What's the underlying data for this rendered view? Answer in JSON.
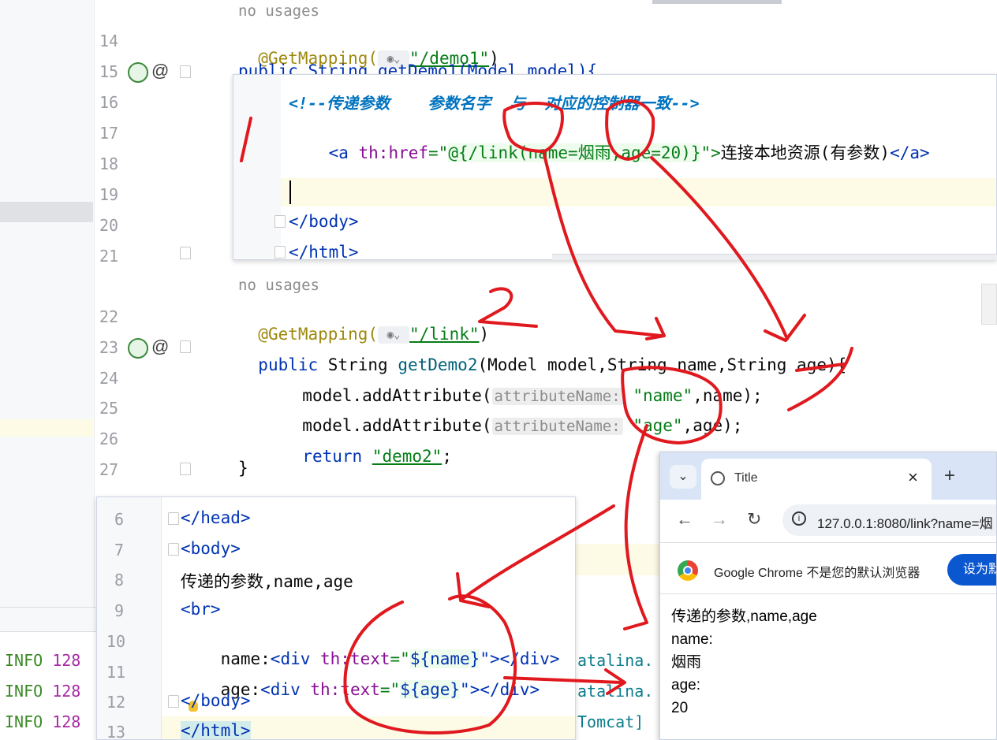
{
  "editor_main": {
    "lines": [
      {
        "num": "",
        "usage": "no usages"
      },
      {
        "num": "14",
        "text": "@GetMapping(\"/demo1\")"
      },
      {
        "num": "15",
        "text": "public String getDemo1(Model model){"
      },
      {
        "num": "16"
      },
      {
        "num": "17"
      },
      {
        "num": "18"
      },
      {
        "num": "19"
      },
      {
        "num": "20"
      },
      {
        "num": "21"
      },
      {
        "num": "",
        "usage": "no usages"
      },
      {
        "num": "22"
      },
      {
        "num": "23"
      },
      {
        "num": "24"
      },
      {
        "num": "25"
      },
      {
        "num": "26"
      },
      {
        "num": "27"
      }
    ],
    "annotation": "@GetMapping(",
    "path_demo1": "\"/demo1\"",
    "path_link": "\"/link\"",
    "close_paren": ")",
    "line15_text": "public String getDemo1(Model model){",
    "line23": {
      "kw": "public",
      "text1": " String ",
      "method": "getDemo2",
      "text2": "(Model model,String name,String age){"
    },
    "line24": {
      "text": "model.addAttribute(",
      "hint": "attributeName:",
      "str": "\"name\"",
      "rest": ",name);"
    },
    "line25": {
      "text": "model.addAttribute(",
      "hint": "attributeName:",
      "str": "\"age\"",
      "rest": ",age);"
    },
    "line26": {
      "kw": "return",
      "str": "\"demo2\"",
      "rest": ";"
    },
    "line27": "}",
    "at_symbol": "@"
  },
  "popup_html1": {
    "comment": "<!--传递参数    参数名字  与  对应的控制器一致-->",
    "line17": {
      "open": "<a",
      "attr": " th:href",
      "eq": "=\"",
      "expr": "@{/link(name=烟雨,age=20)}",
      "close": "\">",
      "text": "连接本地资源(有参数)",
      "end": "</a>"
    },
    "body_close": "</body>",
    "html_close": "</html>"
  },
  "popup_html2": {
    "line_numbers": [
      "6",
      "7",
      "8",
      "9",
      "10",
      "11",
      "12",
      "13"
    ],
    "lines": [
      "</head>",
      "<body>",
      "传递的参数,name,age",
      "<br>",
      "name:<div th:text=\"${name}\"></div>",
      "age:<div th:text=\"${age}\"></div>",
      "</body>",
      "</html>"
    ],
    "line10": {
      "pre": "name:",
      "tag": "<div",
      "attr": " th:text",
      "eq": "=\"",
      "expr": "${name}",
      "close": "\"></div>"
    },
    "line11": {
      "pre": "age:",
      "tag": "<div",
      "attr": " th:text",
      "eq": "=\"",
      "expr": "${age}",
      "close": "\"></div>"
    }
  },
  "console": {
    "rows": [
      {
        "level": "INFO",
        "num": "128",
        "right": "atalina."
      },
      {
        "level": "INFO",
        "num": "128",
        "right": "atalina."
      },
      {
        "level": "INFO",
        "num": "128",
        "right": "Tomcat]"
      }
    ]
  },
  "browser": {
    "tab_title": "Title",
    "close_glyph": "×",
    "new_tab_glyph": "+",
    "url": "127.0.0.1:8080/link?name=烟",
    "notice_text": "Google Chrome 不是您的默认浏览器",
    "default_button": "设为默",
    "content": [
      "传递的参数,name,age",
      "name:",
      "烟雨",
      "age:",
      "20"
    ]
  },
  "annotations_color": "#e0191f"
}
